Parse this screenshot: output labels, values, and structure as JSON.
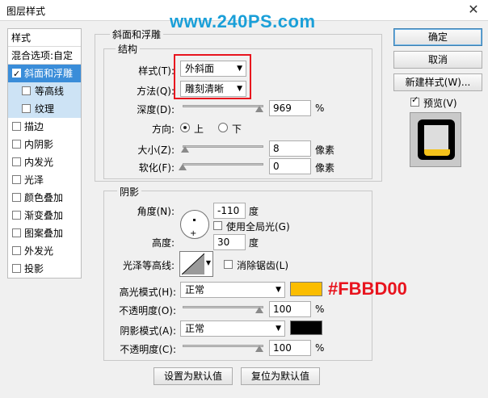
{
  "window": {
    "title": "图层样式",
    "close_glyph": "✕"
  },
  "watermark": "www.240PS.com",
  "sidebar": {
    "header": "样式",
    "blend_options": "混合选项:自定",
    "items": [
      {
        "label": "斜面和浮雕",
        "checked": true
      },
      {
        "label": "等高线",
        "checked": false
      },
      {
        "label": "纹理",
        "checked": false
      },
      {
        "label": "描边",
        "checked": false
      },
      {
        "label": "内阴影",
        "checked": false
      },
      {
        "label": "内发光",
        "checked": false
      },
      {
        "label": "光泽",
        "checked": false
      },
      {
        "label": "颜色叠加",
        "checked": false
      },
      {
        "label": "渐变叠加",
        "checked": false
      },
      {
        "label": "图案叠加",
        "checked": false
      },
      {
        "label": "外发光",
        "checked": false
      },
      {
        "label": "投影",
        "checked": false
      }
    ]
  },
  "bevel": {
    "section_title": "斜面和浮雕",
    "structure_title": "结构",
    "style_label": "样式(T):",
    "style_value": "外斜面",
    "technique_label": "方法(Q):",
    "technique_value": "雕刻清晰",
    "depth_label": "深度(D):",
    "depth_value": "969",
    "depth_unit": "%",
    "depth_fraction": 1.0,
    "direction_label": "方向:",
    "direction_up": "上",
    "direction_down": "下",
    "direction_selected": "上",
    "size_label": "大小(Z):",
    "size_value": "8",
    "size_unit": "像素",
    "size_fraction": 0.03,
    "soften_label": "软化(F):",
    "soften_value": "0",
    "soften_unit": "像素",
    "soften_fraction": 0.0
  },
  "shading": {
    "title": "阴影",
    "angle_label": "角度(N):",
    "angle_value": "-110",
    "angle_unit": "度",
    "global_light_label": "使用全局光(G)",
    "global_light_checked": false,
    "altitude_label": "高度:",
    "altitude_value": "30",
    "altitude_unit": "度",
    "gloss_contour_label": "光泽等高线:",
    "antialias_label": "消除锯齿(L)",
    "antialias_checked": false,
    "highlight_mode_label": "高光模式(H):",
    "highlight_mode_value": "正常",
    "highlight_color": "#FBBD00",
    "highlight_hex_label": "#FBBD00",
    "highlight_opacity_label": "不透明度(O):",
    "highlight_opacity_value": "100",
    "highlight_opacity_unit": "%",
    "highlight_opacity_fraction": 1.0,
    "shadow_mode_label": "阴影模式(A):",
    "shadow_mode_value": "正常",
    "shadow_color": "#000000",
    "shadow_opacity_label": "不透明度(C):",
    "shadow_opacity_value": "100",
    "shadow_opacity_unit": "%",
    "shadow_opacity_fraction": 1.0
  },
  "footer": {
    "make_default": "设置为默认值",
    "reset_default": "复位为默认值"
  },
  "actions": {
    "ok": "确定",
    "cancel": "取消",
    "new_style": "新建样式(W)...",
    "preview_label": "预览(V)",
    "preview_checked": true
  }
}
